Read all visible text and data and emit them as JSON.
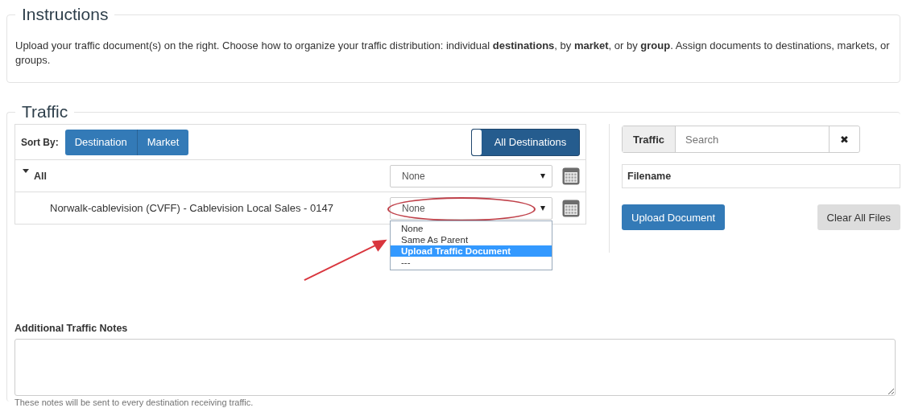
{
  "instructions": {
    "title": "Instructions",
    "text": "Upload your traffic document(s) on the right. Choose how to organize your traffic distribution: individual **destinations**, by **market**, or by **group**. Assign documents to destinations, markets, or groups."
  },
  "traffic": {
    "title": "Traffic",
    "sort_label": "Sort By:",
    "sort_buttons": [
      "Destination",
      "Market"
    ],
    "toggle": {
      "label": "All Destinations",
      "on": true
    },
    "tree": [
      {
        "label": "All",
        "expanded": true,
        "select": "None",
        "children": [
          {
            "label": "Norwalk-cablevision (CVFF) - Cablevision Local Sales - 0147",
            "select": "None",
            "open": true,
            "options": [
              {
                "label": "None",
                "selected": false
              },
              {
                "label": "Same As Parent",
                "selected": false
              },
              {
                "label": "Upload Traffic Document",
                "selected": true
              },
              {
                "label": "---",
                "selected": false
              }
            ]
          }
        ]
      }
    ],
    "search": {
      "addon": "Traffic",
      "placeholder": "Search",
      "clear": "✖"
    },
    "files_header": "Filename",
    "upload_button": "Upload Document",
    "clear_button": "Clear All Files",
    "notes": {
      "label": "Additional Traffic Notes",
      "help": "These notes will be sent to every destination receiving traffic."
    }
  }
}
